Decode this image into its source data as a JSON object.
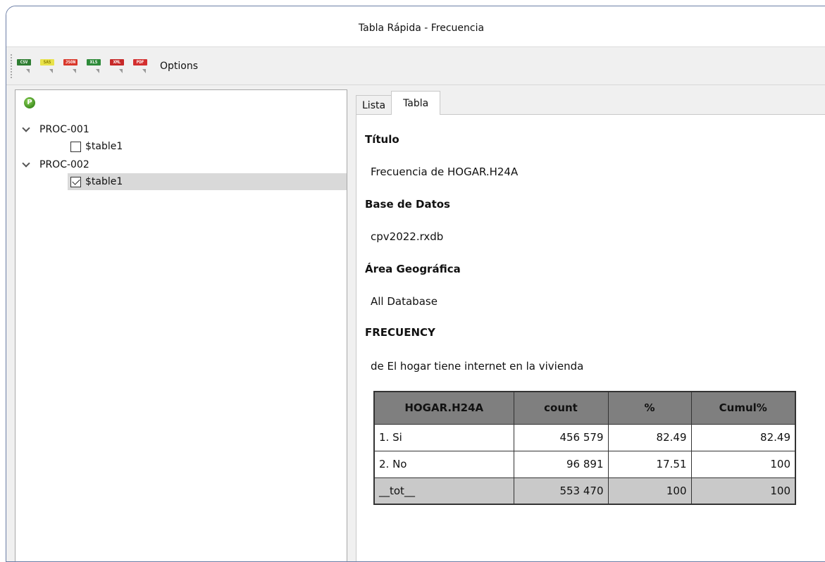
{
  "window": {
    "title": "Tabla Rápida - Frecuencia"
  },
  "toolbar": {
    "buttons": [
      {
        "label": "CSV",
        "color": "#2e7d32"
      },
      {
        "label": "SAS",
        "color": "#e8e24a"
      },
      {
        "label": "JSON",
        "color": "#d9382b"
      },
      {
        "label": "XLS",
        "color": "#2e8b3a"
      },
      {
        "label": "XML",
        "color": "#c62828"
      },
      {
        "label": "PDF",
        "color": "#d32f2f"
      }
    ],
    "options_label": "Options"
  },
  "tree": {
    "items": [
      {
        "label": "PROC-001",
        "child": "$table1",
        "child_checked": false
      },
      {
        "label": "PROC-002",
        "child": "$table1",
        "child_checked": true
      }
    ]
  },
  "tabs": [
    {
      "label": "Lista"
    },
    {
      "label": "Tabla"
    }
  ],
  "report": {
    "title_label": "Título",
    "title_value": "Frecuencia de HOGAR.H24A",
    "database_label": "Base de Datos",
    "database_value": "cpv2022.rxdb",
    "area_label": "Área Geográfica",
    "area_value": "All Database",
    "freq_label": "FRECUENCY",
    "freq_value": "de El hogar tiene internet en la vivienda"
  },
  "table": {
    "headers": [
      "HOGAR.H24A",
      "count",
      "%",
      "Cumul%"
    ],
    "rows": [
      [
        "1. Si",
        "456 579",
        "82.49",
        "82.49"
      ],
      [
        "2. No",
        "96 891",
        "17.51",
        "100"
      ],
      [
        "__tot__",
        "553 470",
        "100",
        "100"
      ]
    ]
  }
}
